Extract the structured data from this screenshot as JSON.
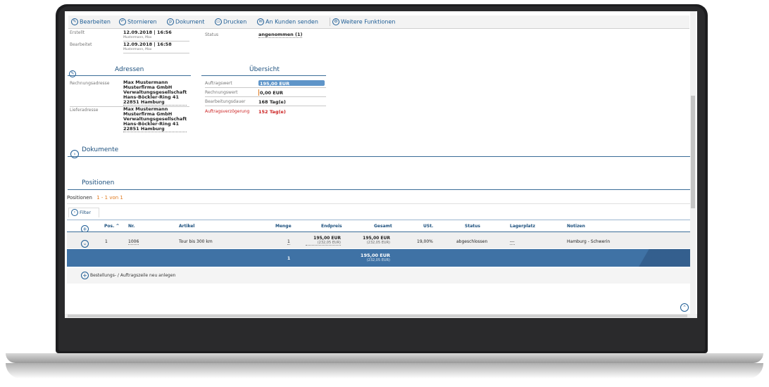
{
  "toolbar": {
    "edit": "Bearbeiten",
    "cancel": "Stornieren",
    "document": "Dokument",
    "print": "Drucken",
    "send": "An Kunden senden",
    "more": "Weitere Funktionen"
  },
  "meta": {
    "created_label": "Erstellt",
    "created_value": "12.09.2018 | 16:56",
    "created_by": "Mustermann, Max",
    "edited_label": "Bearbeitet",
    "edited_value": "12.09.2018 | 16:58",
    "edited_by": "Mustermann, Max",
    "status_label": "Status",
    "status_value": "angenommen (1)"
  },
  "addresses": {
    "title": "Adressen",
    "billing_label": "Rechnungsadresse",
    "billing_lines": [
      "Max Mustermann",
      "Musterfirma GmbH",
      "Verwaltungsgesellschaft",
      "Hans-Böckler-Ring 41",
      "22851 Hamburg"
    ],
    "delivery_label": "Lieferadresse",
    "delivery_lines": [
      "Max Mustermann",
      "Musterfirma GmbH",
      "Verwaltungsgesellschaft",
      "Hans-Böckler-Ring 41",
      "22851 Hamburg"
    ]
  },
  "overview": {
    "title": "Übersicht",
    "order_value_label": "Auftragswert",
    "order_value": "195,00 EUR",
    "invoice_value_label": "Rechnungswert",
    "invoice_value": "0,00 EUR",
    "duration_label": "Bearbeitungsdauer",
    "duration_value": "168 Tag(e)",
    "delay_label": "Auftragsverzögerung",
    "delay_value": "152 Tag(e)"
  },
  "documents": {
    "title": "Dokumente"
  },
  "positions": {
    "title": "Positionen",
    "count_label": "Positionen",
    "count_value": "1 - 1 von 1",
    "filter": "Filter",
    "columns": [
      "Pos.",
      "Nr.",
      "Artikel",
      "Menge",
      "Endpreis",
      "Gesamt",
      "USt.",
      "Status",
      "Lagerplatz",
      "Notizen"
    ],
    "sort_indicator": "^",
    "row": {
      "pos": "1",
      "nr": "1006",
      "article": "Tour bis 300 km",
      "qty": "1",
      "end_price": "195,00 EUR",
      "end_price_gross": "(232,05 EUR)",
      "total": "195,00 EUR",
      "total_gross": "(232,05 EUR)",
      "vat": "19,00%",
      "status": "abgeschlossen",
      "storage": "---",
      "notes": "Hamburg - Schwerin"
    },
    "sum": {
      "qty": "1",
      "total": "195,00 EUR",
      "total_gross": "(232,05 EUR)"
    },
    "add_line": "Bestellungs- / Auftragszeile neu anlegen"
  },
  "colors": {
    "accent": "#1d5c94",
    "sum_bar": "#3f72a5",
    "delay": "#cc2222"
  }
}
